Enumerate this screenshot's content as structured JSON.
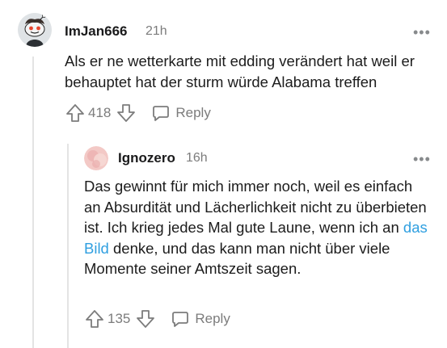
{
  "comments": [
    {
      "username": "ImJan666",
      "time": "21h",
      "more_label": "•••",
      "text": "Als er ne wetterkarte mit edding verändert hat weil er behauptet hat der sturm würde Alabama treffen",
      "score": "418",
      "reply_label": "Reply",
      "icons": [
        "snoo-avatar",
        "upvote-icon",
        "downvote-icon",
        "reply-icon",
        "more-icon"
      ]
    },
    {
      "username": "Ignozero",
      "time": "16h",
      "more_label": "•••",
      "text_before_link": "Das gewinnt für mich immer noch, weil es einfach an Absurdität und Lächerlichkeit nicht zu überbieten ist. Ich krieg jedes Mal gute Laune, wenn ich an ",
      "link_text": "das Bild",
      "text_after_link": " denke, und das kann man nicht über viele Momente seiner Amtszeit sagen.",
      "score": "135",
      "reply_label": "Reply",
      "colors": {
        "link": "#2f9fe0",
        "avatar": "#f3c9c6"
      }
    }
  ]
}
